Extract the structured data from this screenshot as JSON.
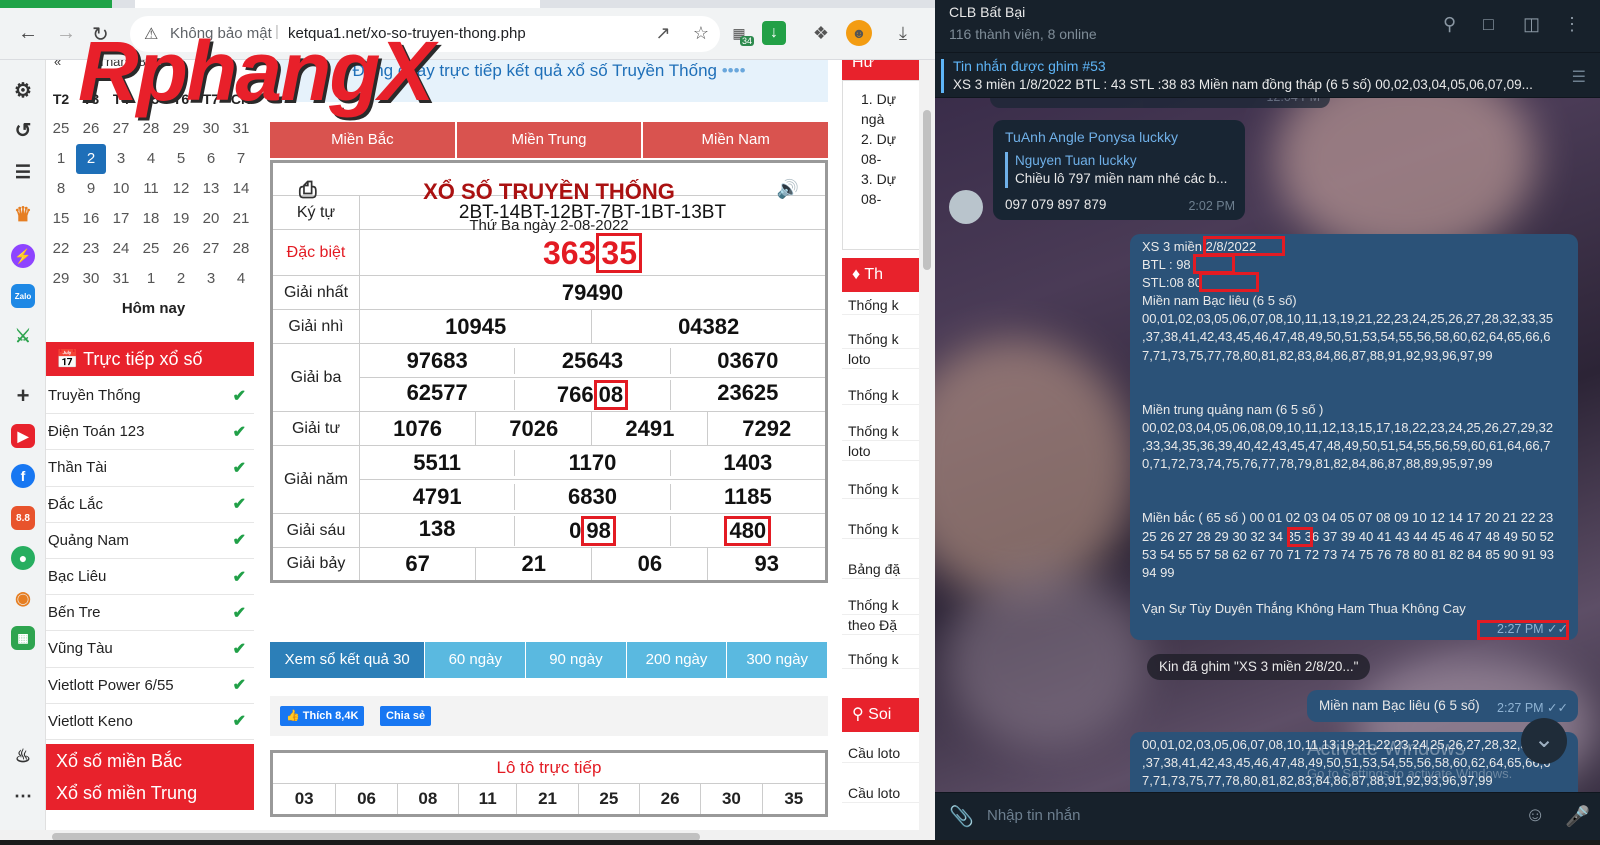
{
  "browser": {
    "not_secure": "Không bảo mật",
    "url": "ketqua1.net/xo-so-truyen-thong.php",
    "extension_badge": "34",
    "watermark": "RphangX"
  },
  "calendar": {
    "prev": "«",
    "month_label": "Tháng 8 2022",
    "weekdays": [
      "T2",
      "T3",
      "T4",
      "T5",
      "T6",
      "T7",
      "CN"
    ],
    "weeks": [
      [
        "25",
        "26",
        "27",
        "28",
        "29",
        "30",
        "31"
      ],
      [
        "1",
        "2",
        "3",
        "4",
        "5",
        "6",
        "7"
      ],
      [
        "8",
        "9",
        "10",
        "11",
        "12",
        "13",
        "14"
      ],
      [
        "15",
        "16",
        "17",
        "18",
        "19",
        "20",
        "21"
      ],
      [
        "22",
        "23",
        "24",
        "25",
        "26",
        "27",
        "28"
      ],
      [
        "29",
        "30",
        "31",
        "1",
        "2",
        "3",
        "4"
      ]
    ],
    "today_label": "Hôm nay"
  },
  "sidebar": {
    "live_header": "Trực tiếp xổ số",
    "items": [
      "Truyền Thống",
      "Điện Toán 123",
      "Thần Tài",
      "Đắc Lắc",
      "Quảng Nam",
      "Bạc Liêu",
      "Bến Tre",
      "Vũng Tàu",
      "Vietlott Power 6/55",
      "Vietlott Keno"
    ],
    "bottom": [
      "Xổ số miền Bắc",
      "Xổ số miền Trung"
    ]
  },
  "center": {
    "live_text": "Đang quay trực tiếp kết quả xổ số Truyền Thống",
    "live_dots": "••••",
    "regions": [
      "Miền Bắc",
      "Miền Trung",
      "Miền Nam"
    ],
    "title": "XỔ SỐ TRUYỀN THỐNG",
    "date": "Thứ Ba ngày 2-08-2022",
    "results": {
      "kytu_label": "Ký tự",
      "kytu": "2BT-14BT-12BT-7BT-1BT-13BT",
      "db_label": "Đặc biệt",
      "db_a": "363",
      "db_b": "35",
      "g1_label": "Giải nhất",
      "g1": "79490",
      "g2_label": "Giải nhì",
      "g2": [
        "10945",
        "04382"
      ],
      "g3_label": "Giải ba",
      "g3": [
        "97683",
        "25643",
        "03670",
        "62577",
        "766",
        "08",
        "23625"
      ],
      "g4_label": "Giải tư",
      "g4": [
        "1076",
        "7026",
        "2491",
        "7292"
      ],
      "g5_label": "Giải năm",
      "g5": [
        "5511",
        "1170",
        "1403",
        "4791",
        "6830",
        "1185"
      ],
      "g6_label": "Giải sáu",
      "g6": [
        "138",
        "0",
        "98",
        "480"
      ],
      "g7_label": "Giải bảy",
      "g7": [
        "67",
        "21",
        "06",
        "93"
      ]
    },
    "days": [
      "Xem sổ kết quả 30 ngày",
      "60 ngày",
      "90 ngày",
      "200 ngày",
      "300 ngày"
    ],
    "like": "Thích 8,4K",
    "share": "Chia sẻ",
    "loto_title": "Lô tô trực tiếp",
    "loto": [
      "03",
      "06",
      "08",
      "11",
      "21",
      "25",
      "26",
      "30",
      "35"
    ]
  },
  "right": {
    "top_frag": "Hư",
    "pred": [
      "1. Dự",
      "ngà",
      "2. Dự",
      "08-",
      "3. Dự",
      "08-"
    ],
    "stats_head": "Th",
    "stats": [
      "Thống k",
      "Thống k",
      "loto",
      "Thống k",
      "Thống k",
      "loto",
      "Thống k",
      "Thống k",
      "Bảng đặ",
      "Thống k",
      "theo Đặ",
      "Thống k"
    ],
    "soi_head": "Soi",
    "soi": [
      "Cầu loto",
      "Cầu loto"
    ]
  },
  "telegram": {
    "name": "CLB Bất Bại",
    "members": "116 thành viên, 8 online",
    "pinned_title": "Tin nhắn được ghim #53",
    "pinned_text": "XS 3 miền 1/8/2022  BTL : 43 STL :38 83 Miền nam đồng tháp (6 5 số) 00,02,03,04,05,06,07,09...",
    "partial_time": "12:04 PM",
    "msg1": {
      "sender": "TuAnh Angle Ponysa luckky",
      "reply_name": "Nguyen Tuan luckky",
      "reply_text": "Chiều lô 797 miền nam nhé các b...",
      "text": "097 079 897 879",
      "time": "2:02 PM"
    },
    "msg2": {
      "lines": [
        "XS 3 miền 2/8/2022",
        "BTL : 98",
        "STL:08 80",
        "Miền nam Bạc liêu (6 5 số)",
        "00,01,02,03,05,06,07,08,10,11,13,19,21,22,23,24,25,26,27,28,32,33,35",
        ",37,38,41,42,43,45,46,47,48,49,50,51,53,54,55,56,58,60,62,64,65,66,6",
        "7,71,73,75,77,78,80,81,82,83,84,86,87,88,91,92,93,96,97,99",
        "",
        "",
        "Miền trung quảng nam (6 5 số )",
        "00,02,03,04,05,06,08,09,10,11,12,13,15,17,18,22,23,24,25,26,27,29,32",
        ",33,34,35,36,39,40,42,43,45,47,48,49,50,51,54,55,56,59,60,61,64,66,7",
        "0,71,72,73,74,75,76,77,78,79,81,82,84,86,87,88,89,95,97,99",
        "",
        "",
        "Miền bắc ( 65 số ) 00 01 02 03 04 05 07 08 09 10 12 14 17 20 21 22 23",
        "25 26 27 28 29 30 32 34 35 36 37 39 40 41 43 44 45 46 47 48 49 50 52",
        "53 54 55 57 58 62 67 70 71 72 73 74 75 76 78 80 81 82 84 85 90 91 93",
        "94 99",
        "",
        "Vạn Sự Tùy Duyên Thắng Không Ham Thua Không Cay"
      ],
      "time": "2:27 PM"
    },
    "pin_notice": "Kin đã ghim \"XS 3 miền 2/8/20...\"",
    "msg3": {
      "text": "Miền nam Bạc liêu (6 5 số)",
      "time": "2:27 PM"
    },
    "msg4": {
      "lines": [
        "00,01,02,03,05,06,07,08,10,11,13,19,21,22,23,24,25,26,27,28,32,3",
        ",37,38,41,42,43,45,46,47,48,49,50,51,53,54,55,56,58,60,62,64,65,66,6",
        "7,71,73,75,77,78,80,81,82,83,84,86,87,88,91,92,93,96,97,99"
      ]
    },
    "activate": "Activate Windows",
    "activate_sub": "Go to Settings to activate Windows.",
    "compose_placeholder": "Nhập tin nhắn"
  }
}
